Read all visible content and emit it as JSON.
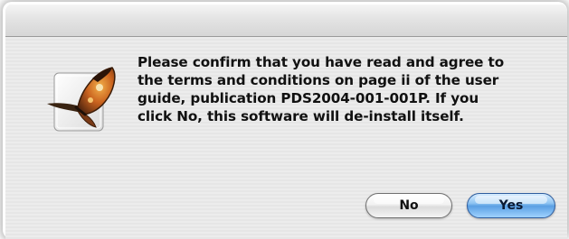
{
  "dialog": {
    "message_lines": [
      "Please confirm that you have read and agree to",
      "the terms and conditions on page ii of the user",
      "guide, publication PDS2004-001-001P. If you",
      "click No, this software will de-install itself."
    ],
    "icon": "butterfly-app-icon"
  },
  "buttons": {
    "no_label": "No",
    "yes_label": "Yes"
  },
  "colors": {
    "window_bg": "#ececec",
    "default_button": "#5a9fe3"
  }
}
